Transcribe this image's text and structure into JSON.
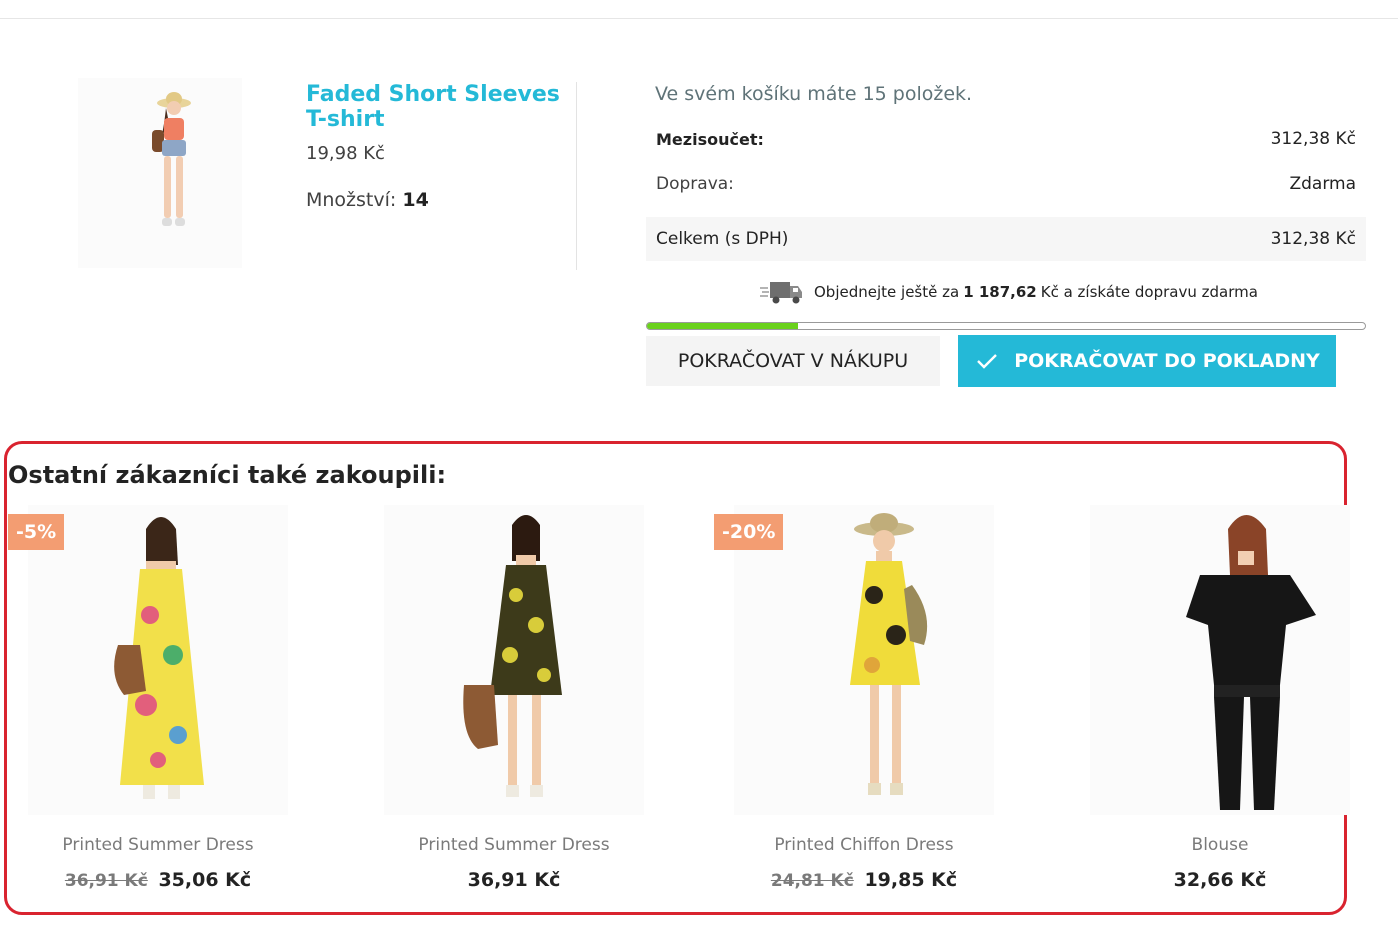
{
  "product": {
    "name": "Faded Short Sleeves T-shirt",
    "price": "19,98 Kč",
    "qty_label": "Množství:",
    "qty_value": "14"
  },
  "cart": {
    "count_text": "Ve svém košíku máte 15 položek.",
    "subtotal_label": "Mezisoučet:",
    "subtotal_value": "312,38 Kč",
    "shipping_label": "Doprava:",
    "shipping_value": "Zdarma",
    "total_label": "Celkem (s DPH)",
    "total_value": "312,38 Kč",
    "free_ship_prefix": "Objednejte ještě za",
    "free_ship_amount": "1 187,62",
    "free_ship_suffix": "Kč a získáte dopravu zdarma",
    "free_ship_progress": 0.21,
    "progress_color": "#6ad11c"
  },
  "buttons": {
    "continue_label": "POKRAČOVAT V NÁKUPU",
    "checkout_label": "POKRAČOVAT DO POKLADNY"
  },
  "recommendations": {
    "title": "Ostatní zákazníci také zakoupili:",
    "items": [
      {
        "name": "Printed Summer Dress",
        "badge": "-5%",
        "old_price": "36,91 Kč",
        "price": "35,06 Kč"
      },
      {
        "name": "Printed Summer Dress",
        "badge": "",
        "old_price": "",
        "price": "36,91 Kč"
      },
      {
        "name": "Printed Chiffon Dress",
        "badge": "-20%",
        "old_price": "24,81 Kč",
        "price": "19,85 Kč"
      },
      {
        "name": "Blouse",
        "badge": "",
        "old_price": "",
        "price": "32,66 Kč"
      }
    ]
  },
  "colors": {
    "accent": "#24b9d7",
    "badge": "#f39d72",
    "highlight_border": "#d9232f"
  }
}
